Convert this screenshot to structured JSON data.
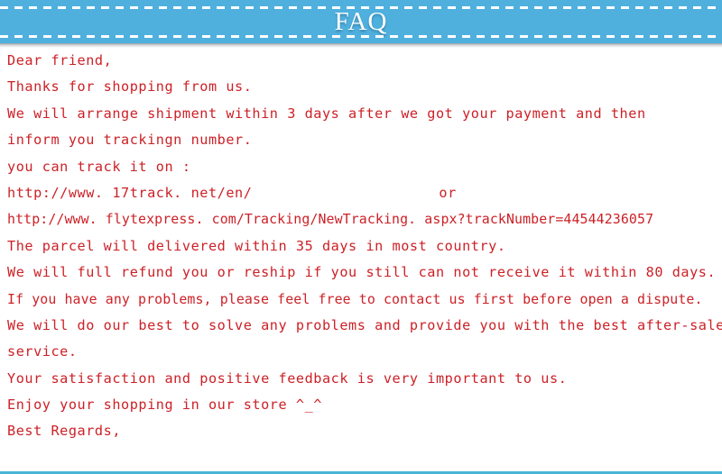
{
  "banner": {
    "title": "FAQ",
    "background_color": "#4fb0de",
    "title_color": "#ffffff",
    "dash_color": "#ffffff"
  },
  "body": {
    "text_color": "#cc2127",
    "lines": [
      "Dear friend,",
      "Thanks for shopping from us.",
      "We will arrange shipment within 3 days after we got your payment and then",
      "inform you trackingn number.",
      "you can track it on :",
      "The parcel will delivered within 35 days in most country.",
      "We will full refund you or reship if you still can not receive it within 80 days.",
      "If you have any problems, please feel free to contact us first before open a dispute.",
      "We will do our best to solve any problems and provide you with the best after-sale",
      "service.",
      "Your satisfaction and positive feedback is very important to us.",
      "Enjoy your shopping in our store ^_^",
      "Best Regards,"
    ],
    "tracking_line_1": "http://www. 17track. net/en/",
    "tracking_line_1_suffix": "or",
    "tracking_line_2": "http://www. flytexpress. com/Tracking/NewTracking. aspx?trackNumber=44544236057"
  },
  "bottom_rule": {
    "color": "#49b5d6"
  }
}
